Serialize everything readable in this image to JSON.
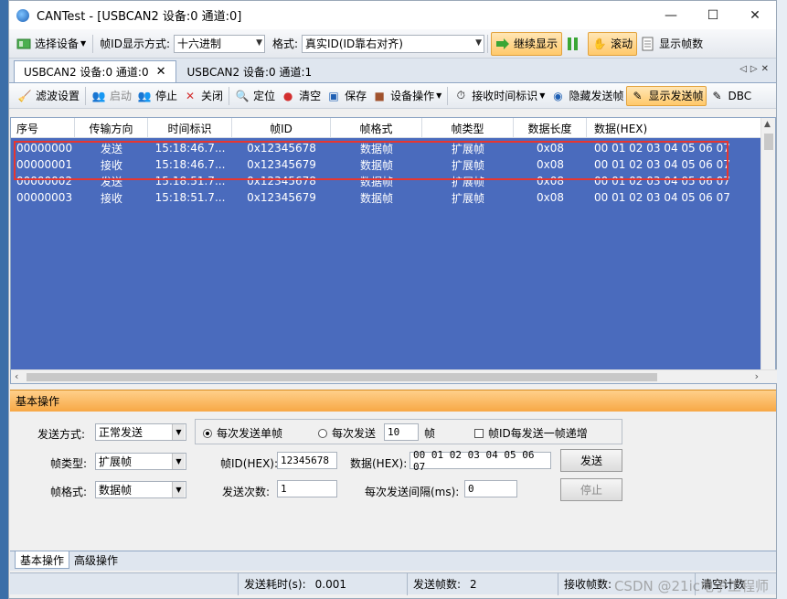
{
  "window": {
    "title": "CANTest  - [USBCAN2 设备:0 通道:0]",
    "minimize": "—",
    "maximize": "☐",
    "close": "✕"
  },
  "toolbar1": {
    "select_device": "选择设备",
    "id_display_label": "帧ID显示方式:",
    "id_display_value": "十六进制",
    "format_label": "格式:",
    "format_value": "真实ID(ID靠右对齐)",
    "continue_display": "继续显示",
    "scroll": "滚动",
    "show_frame_count": "显示帧数"
  },
  "tabs": [
    {
      "label": "USBCAN2 设备:0 通道:0"
    },
    {
      "label": "USBCAN2 设备:0 通道:1"
    }
  ],
  "toolbar2": {
    "filter": "滤波设置",
    "start": "启动",
    "stop": "停止",
    "close": "关闭",
    "locate": "定位",
    "clear": "清空",
    "save": "保存",
    "device_ops": "设备操作",
    "recv_time": "接收时间标识",
    "hide_send": "隐藏发送帧",
    "show_send": "显示发送帧",
    "dbc": "DBC"
  },
  "grid": {
    "columns": [
      "序号",
      "传输方向",
      "时间标识",
      "帧ID",
      "帧格式",
      "帧类型",
      "数据长度",
      "数据(HEX)"
    ],
    "rows": [
      [
        "00000000",
        "发送",
        "15:18:46.7...",
        "0x12345678",
        "数据帧",
        "扩展帧",
        "0x08",
        "00 01 02 03 04 05 06 07"
      ],
      [
        "00000001",
        "接收",
        "15:18:46.7...",
        "0x12345679",
        "数据帧",
        "扩展帧",
        "0x08",
        "00 01 02 03 04 05 06 07"
      ],
      [
        "00000002",
        "发送",
        "15:18:51.7...",
        "0x12345678",
        "数据帧",
        "扩展帧",
        "0x08",
        "00 01 02 03 04 05 06 07"
      ],
      [
        "00000003",
        "接收",
        "15:18:51.7...",
        "0x12345679",
        "数据帧",
        "扩展帧",
        "0x08",
        "00 01 02 03 04 05 06 07"
      ]
    ]
  },
  "panel": {
    "title": "基本操作",
    "send_mode_label": "发送方式:",
    "send_mode_value": "正常发送",
    "radio_single": "每次发送单帧",
    "radio_multi": "每次发送",
    "multi_count": "10",
    "multi_unit": "帧",
    "id_increment": "帧ID每发送一帧递增",
    "frame_type_label": "帧类型:",
    "frame_type_value": "扩展帧",
    "frame_id_label": "帧ID(HEX):",
    "frame_id_value": "12345678",
    "data_label": "数据(HEX):",
    "data_value": "00 01 02 03 04 05 06 07",
    "send_button": "发送",
    "frame_format_label": "帧格式:",
    "frame_format_value": "数据帧",
    "send_times_label": "发送次数:",
    "send_times_value": "1",
    "interval_label": "每次发送间隔(ms):",
    "interval_value": "0",
    "stop_button": "停止"
  },
  "bottom_tabs": [
    "基本操作",
    "高级操作"
  ],
  "status": {
    "elapsed_label": "发送耗时(s):",
    "elapsed_value": "0.001",
    "sent_label": "发送帧数:",
    "sent_value": "2",
    "recv_label": "接收帧数:",
    "clear_label": "清空计数"
  },
  "watermark": "CSDN @21ic电子工程师"
}
